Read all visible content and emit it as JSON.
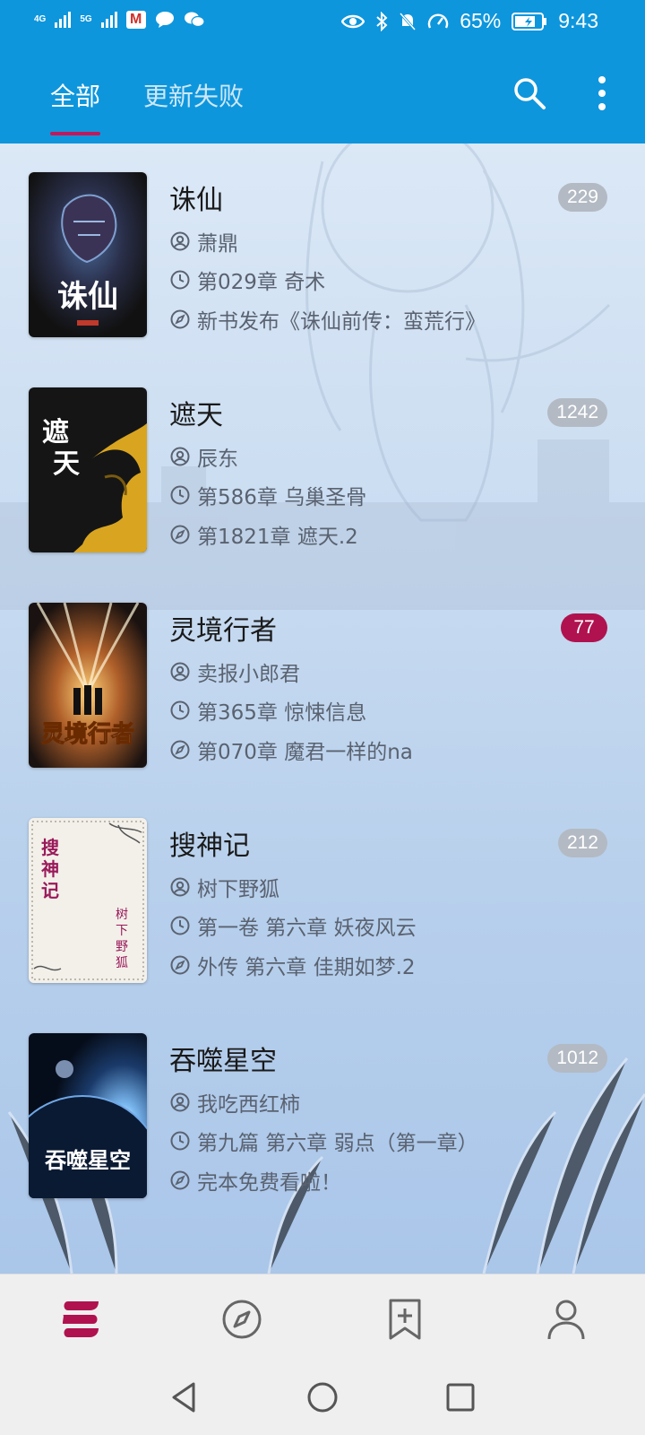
{
  "status_bar": {
    "net1": "4G",
    "net2": "5G",
    "battery": "65%",
    "time": "9:43"
  },
  "tabs": [
    {
      "label": "全部",
      "active": true
    },
    {
      "label": "更新失败",
      "active": false
    }
  ],
  "books": [
    {
      "title": "诛仙",
      "count": "229",
      "highlight": false,
      "author": "萧鼎",
      "latest": "第029章 奇术",
      "read": "新书发布《诛仙前传：蛮荒行》",
      "cover_text": "诛仙"
    },
    {
      "title": "遮天",
      "count": "1242",
      "highlight": false,
      "author": "辰东",
      "latest": "第586章 乌巢圣骨",
      "read": "第1821章 遮天.2",
      "cover_text": "遮天"
    },
    {
      "title": "灵境行者",
      "count": "77",
      "highlight": true,
      "author": "卖报小郎君",
      "latest": "第365章 惊悚信息",
      "read": "第070章 魔君一样的na",
      "cover_text": "灵境行者"
    },
    {
      "title": "搜神记",
      "count": "212",
      "highlight": false,
      "author": "树下野狐",
      "latest": "第一卷 第六章 妖夜风云",
      "read": "外传 第六章 佳期如梦.2",
      "cover_text": "搜神记",
      "cover_author": "树下野狐"
    },
    {
      "title": "吞噬星空",
      "count": "1012",
      "highlight": false,
      "author": "我吃西红柿",
      "latest": "第九篇 第六章 弱点（第一章）",
      "read": "完本免费看啦！",
      "cover_text": "吞噬星空"
    }
  ],
  "bottom_nav": [
    "bookshelf-icon",
    "compass-icon",
    "bookmark-add-icon",
    "profile-icon"
  ],
  "colors": {
    "primary": "#0e96dd",
    "accent": "#b0124f"
  }
}
